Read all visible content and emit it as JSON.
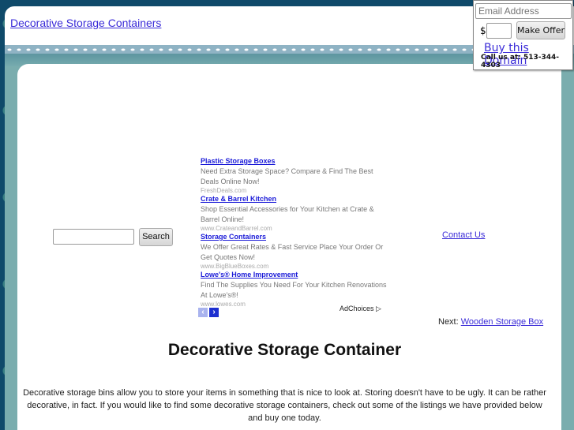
{
  "header": {
    "site_title": "Decorative Storage Containers"
  },
  "offer_box": {
    "email_placeholder": "Email Address",
    "currency_symbol": "$",
    "amount_value": "",
    "make_offer_label": "Make Offer",
    "buy_link": "Buy this Domain",
    "call_text": "Call us at: 513-344-4303"
  },
  "search": {
    "input_value": "",
    "button_label": "Search"
  },
  "ads": [
    {
      "title": "Plastic Storage Boxes",
      "description": "Need Extra Storage Space? Compare & Find The Best Deals Online Now!",
      "url": "FreshDeals.com"
    },
    {
      "title": "Crate & Barrel Kitchen",
      "description": "Shop Essential Accessories for Your Kitchen at Crate & Barrel Online!",
      "url": "www.CrateandBarrel.com"
    },
    {
      "title": "Storage Containers",
      "description": "We Offer Great Rates & Fast Service Place Your Order Or Get Quotes Now!",
      "url": "www.BigBlueBoxes.com"
    },
    {
      "title": "Lowe's® Home Improvement",
      "description": "Find The Supplies You Need For Your Kitchen Renovations At Lowe's®!",
      "url": "www.lowes.com"
    }
  ],
  "ad_nav": {
    "prev_icon": "‹",
    "next_icon": "›",
    "adchoices_label": "AdChoices ▷"
  },
  "links": {
    "contact_us": "Contact Us",
    "next_prefix": "Next: ",
    "next_link": "Wooden Storage Box"
  },
  "main": {
    "title": "Decorative Storage Container",
    "intro": "Decorative storage bins allow you to store your items in something that is nice to look at. Storing doesn't have to be ugly. It can be rather decorative, in fact. If you would like to find some decorative storage containers, check out some of the listings we have provided below and buy one today."
  },
  "colors": {
    "link": "#3a2bd8",
    "background_dark": "#0f4a6a",
    "frame_teal": "#7aadae"
  }
}
